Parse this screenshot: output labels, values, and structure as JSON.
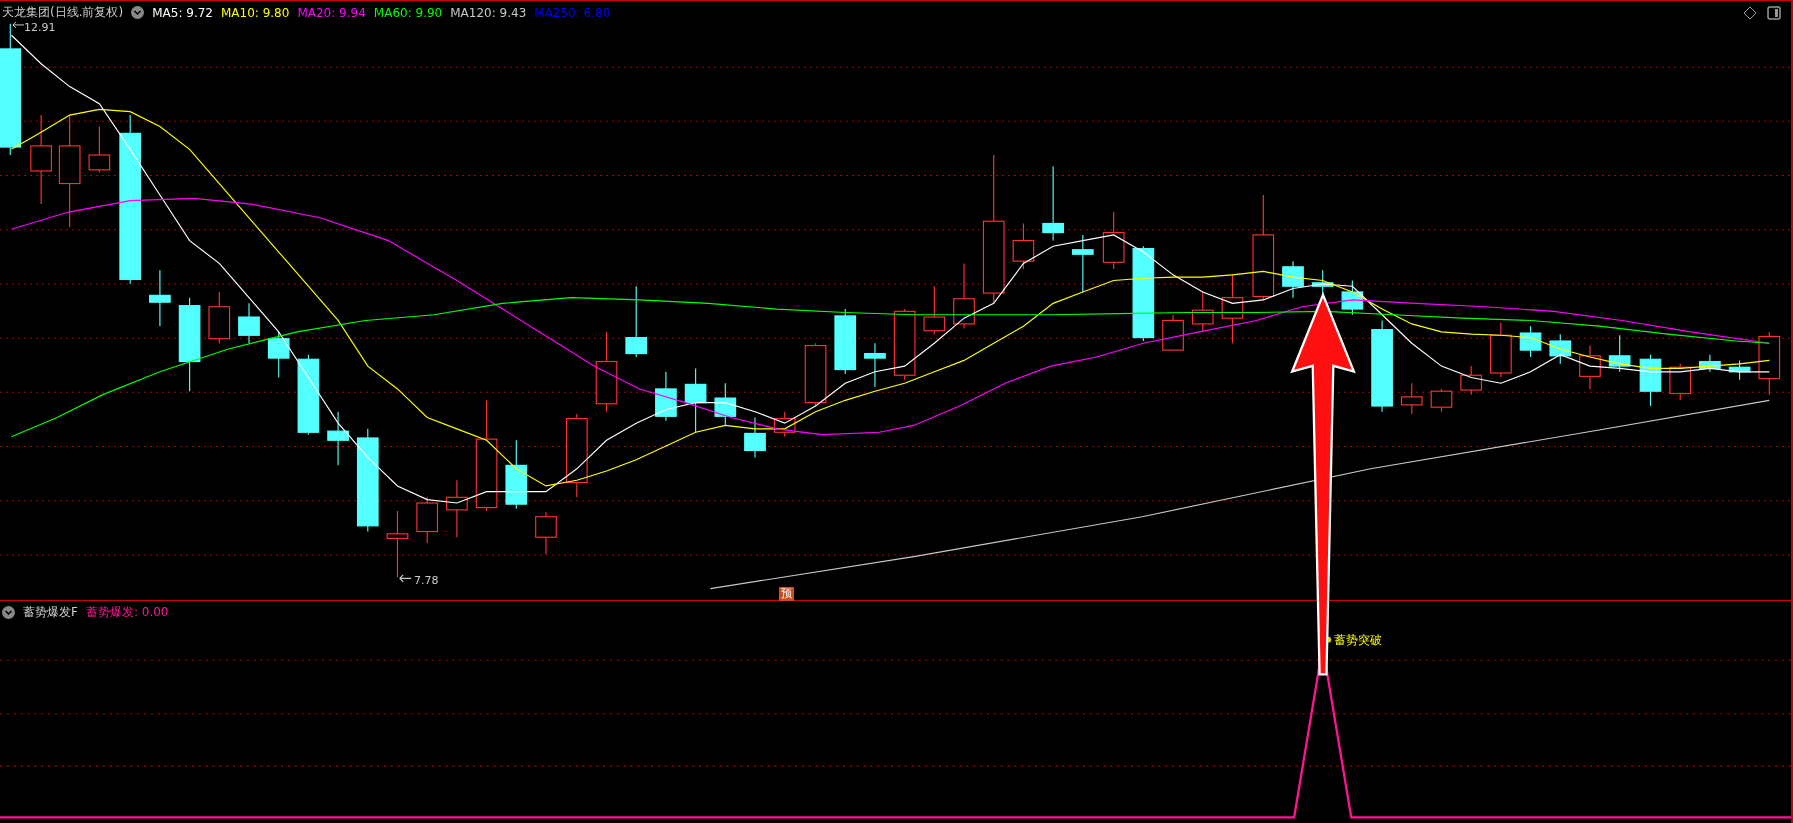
{
  "main_panel": {
    "title": "天龙集团(日线.前复权)",
    "moving_averages": [
      {
        "label": "MA5: 9.72",
        "color": "#ffffff"
      },
      {
        "label": "MA10: 9.80",
        "color": "#ffff00"
      },
      {
        "label": "MA20: 9.94",
        "color": "#ff00ff"
      },
      {
        "label": "MA60: 9.90",
        "color": "#00ff00"
      },
      {
        "label": "MA120: 9.43",
        "color": "#c8c8c8"
      },
      {
        "label": "MA250: 6.80",
        "color": "#0000ff"
      }
    ],
    "max_label": "12.91",
    "min_label": "7.78",
    "marker_badge": "预"
  },
  "indicator_panel": {
    "name": "蓄势爆发F",
    "value_label": "蓄势爆发: 0.00",
    "signal_label": "蓄势突破"
  }
}
